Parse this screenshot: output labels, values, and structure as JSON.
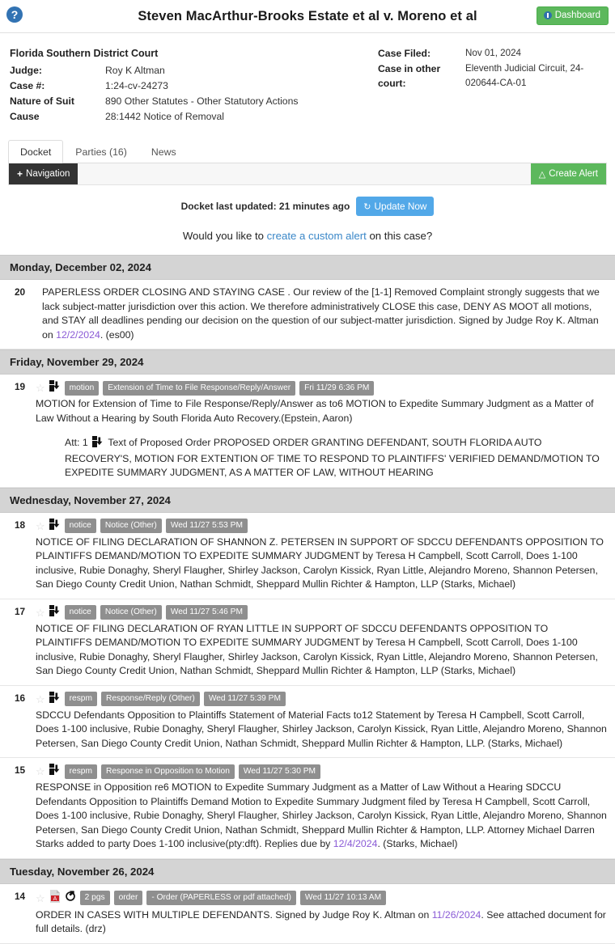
{
  "header": {
    "help_icon": "question-circle-icon",
    "case_title": "Steven MacArthur-Brooks Estate et al v. Moreno et al",
    "dashboard_label": "Dashboard"
  },
  "case_meta": {
    "court_name": "Florida Southern District Court",
    "left_rows": [
      {
        "label": "Judge:",
        "value": "Roy K Altman"
      },
      {
        "label": "Case #:",
        "value": "1:24-cv-24273"
      },
      {
        "label": "Nature of Suit",
        "value": "890 Other Statutes - Other Statutory Actions"
      },
      {
        "label": "Cause",
        "value": "28:1442 Notice of Removal"
      }
    ],
    "right_rows": [
      {
        "label": "Case Filed:",
        "value": "Nov 01, 2024"
      },
      {
        "label": "Case in other court:",
        "value": "Eleventh Judicial Circuit, 24-020644-CA-01"
      }
    ]
  },
  "tabs": [
    {
      "label": "Docket",
      "active": true
    },
    {
      "label": "Parties (16)",
      "active": false
    },
    {
      "label": "News",
      "active": false
    }
  ],
  "toolbar": {
    "navigation_label": "Navigation",
    "navigation_plus": "+",
    "create_alert_label": "Create Alert",
    "bell_icon": "bell-icon"
  },
  "update": {
    "status_text": "Docket last updated: 21 minutes ago",
    "button_label": "Update Now",
    "refresh_icon": "refresh-icon"
  },
  "custom_alert": {
    "prefix": "Would you like to ",
    "link_text": "create a custom alert",
    "suffix": " on this case?"
  },
  "colors": {
    "accent_green": "#5cb85c",
    "accent_blue": "#52a8e8",
    "link_blue": "#3a87c8",
    "date_link_purple": "#8a5bd6",
    "badge_gray": "#8f8f8f",
    "date_header_bg": "#d4d4d4",
    "nav_dark": "#333333"
  },
  "docket": [
    {
      "date_header": "Monday, December 02, 2024",
      "entries": [
        {
          "number": "20",
          "has_badges": false,
          "star": false,
          "icons": [],
          "badges": [],
          "text_parts": [
            {
              "t": "PAPERLESS ORDER CLOSING AND STAYING CASE . Our review of the [1-1] Removed Complaint strongly suggests that we lack subject-matter jurisdiction over this action. We therefore administratively CLOSE this case, DENY AS MOOT all motions, and STAY all deadlines pending our decision on the question of our subject-matter jurisdiction. Signed by Judge Roy K. Altman on ",
              "link": false
            },
            {
              "t": "12/2/2024",
              "link": true
            },
            {
              "t": ". (es00)",
              "link": false
            }
          ],
          "attachment": null
        }
      ]
    },
    {
      "date_header": "Friday, November 29, 2024",
      "entries": [
        {
          "number": "19",
          "has_badges": true,
          "star": true,
          "icons": [
            "save-download-icon"
          ],
          "badges": [
            "motion",
            "Extension of Time to File Response/Reply/Answer",
            "Fri 11/29 6:36 PM"
          ],
          "text_parts": [
            {
              "t": "MOTION for Extension of Time to File Response/Reply/Answer as to6 MOTION to Expedite Summary Judgment as a Matter of Law Without a Hearing by South Florida Auto Recovery.(Epstein, Aaron)",
              "link": false
            }
          ],
          "attachment": {
            "prefix": "Att: 1",
            "icon": "save-download-icon",
            "text": "Text of Proposed Order PROPOSED ORDER GRANTING DEFENDANT, SOUTH FLORIDA AUTO RECOVERY'S, MOTION FOR EXTENTION OF TIME TO RESPOND TO PLAINTIFFS' VERIFIED DEMAND/MOTION TO EXPEDITE SUMMARY JUDGMENT, AS A MATTER OF LAW, WITHOUT HEARING"
          }
        }
      ]
    },
    {
      "date_header": "Wednesday, November 27, 2024",
      "entries": [
        {
          "number": "18",
          "has_badges": true,
          "star": true,
          "icons": [
            "save-download-icon"
          ],
          "badges": [
            "notice",
            "Notice (Other)",
            "Wed 11/27 5:53 PM"
          ],
          "text_parts": [
            {
              "t": "NOTICE OF FILING DECLARATION OF SHANNON Z. PETERSEN IN SUPPORT OF SDCCU DEFENDANTS OPPOSITION TO PLAINTIFFS DEMAND/MOTION TO EXPEDITE SUMMARY JUDGMENT by Teresa H Campbell, Scott Carroll, Does 1-100 inclusive, Rubie Donaghy, Sheryl Flaugher, Shirley Jackson, Carolyn Kissick, Ryan Little, Alejandro Moreno, Shannon Petersen, San Diego County Credit Union, Nathan Schmidt, Sheppard Mullin Richter & Hampton, LLP (Starks, Michael)",
              "link": false
            }
          ],
          "attachment": null
        },
        {
          "number": "17",
          "has_badges": true,
          "star": true,
          "icons": [
            "save-download-icon"
          ],
          "badges": [
            "notice",
            "Notice (Other)",
            "Wed 11/27 5:46 PM"
          ],
          "text_parts": [
            {
              "t": "NOTICE OF FILING DECLARATION OF RYAN LITTLE IN SUPPORT OF SDCCU DEFENDANTS OPPOSITION TO PLAINTIFFS DEMAND/MOTION TO EXPEDITE SUMMARY JUDGMENT by Teresa H Campbell, Scott Carroll, Does 1-100 inclusive, Rubie Donaghy, Sheryl Flaugher, Shirley Jackson, Carolyn Kissick, Ryan Little, Alejandro Moreno, Shannon Petersen, San Diego County Credit Union, Nathan Schmidt, Sheppard Mullin Richter & Hampton, LLP (Starks, Michael)",
              "link": false
            }
          ],
          "attachment": null
        },
        {
          "number": "16",
          "has_badges": true,
          "star": true,
          "icons": [
            "save-download-icon"
          ],
          "badges": [
            "respm",
            "Response/Reply (Other)",
            "Wed 11/27 5:39 PM"
          ],
          "text_parts": [
            {
              "t": "SDCCU Defendants Opposition to Plaintiffs Statement of Material Facts to12 Statement by Teresa H Campbell, Scott Carroll, Does 1-100 inclusive, Rubie Donaghy, Sheryl Flaugher, Shirley Jackson, Carolyn Kissick, Ryan Little, Alejandro Moreno, Shannon Petersen, San Diego County Credit Union, Nathan Schmidt, Sheppard Mullin Richter & Hampton, LLP. (Starks, Michael)",
              "link": false
            }
          ],
          "attachment": null
        },
        {
          "number": "15",
          "has_badges": true,
          "star": true,
          "icons": [
            "save-download-icon"
          ],
          "badges": [
            "respm",
            "Response in Opposition to Motion",
            "Wed 11/27 5:30 PM"
          ],
          "text_parts": [
            {
              "t": "RESPONSE in Opposition re6 MOTION to Expedite Summary Judgment as a Matter of Law Without a Hearing SDCCU Defendants Opposition to Plaintiffs Demand Motion to Expedite Summary Judgment filed by Teresa H Campbell, Scott Carroll, Does 1-100 inclusive, Rubie Donaghy, Sheryl Flaugher, Shirley Jackson, Carolyn Kissick, Ryan Little, Alejandro Moreno, Shannon Petersen, San Diego County Credit Union, Nathan Schmidt, Sheppard Mullin Richter & Hampton, LLP. Attorney Michael Darren Starks added to party Does 1-100 inclusive(pty:dft). Replies due by ",
              "link": false
            },
            {
              "t": "12/4/2024",
              "link": true
            },
            {
              "t": ". (Starks, Michael)",
              "link": false
            }
          ],
          "attachment": null
        }
      ]
    },
    {
      "date_header": "Tuesday, November 26, 2024",
      "entries": [
        {
          "number": "14",
          "has_badges": true,
          "star": true,
          "icons": [
            "pdf-icon",
            "external-link-icon"
          ],
          "badges": [
            "2 pgs",
            "order",
            "- Order (PAPERLESS or pdf attached)",
            "Wed 11/27 10:13 AM"
          ],
          "text_parts": [
            {
              "t": "ORDER IN CASES WITH MULTIPLE DEFENDANTS. Signed by Judge Roy K. Altman on ",
              "link": false
            },
            {
              "t": "11/26/2024",
              "link": true
            },
            {
              "t": ". See attached document for full details. (drz)",
              "link": false
            }
          ],
          "attachment": null
        }
      ]
    }
  ]
}
